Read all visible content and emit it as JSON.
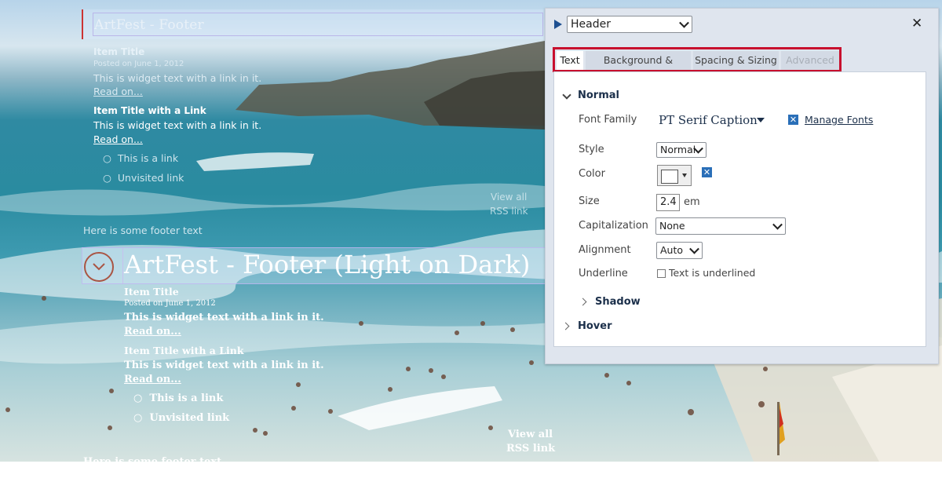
{
  "footer_overlay": {
    "section_title": "ArtFest - Footer",
    "items": [
      {
        "title": "Item Title",
        "date": "Posted on June 1, 2012",
        "text": "This is widget text with a link in it.",
        "read_more": "Read on..."
      },
      {
        "title": "Item Title with a Link",
        "text": "This is widget text with a link in it.",
        "read_more": "Read on..."
      }
    ],
    "links": [
      "This is a link",
      "Unvisited link"
    ],
    "view_all": "View all",
    "rss": "RSS link",
    "footer_text": "Here is some footer text"
  },
  "dark_overlay": {
    "section_title": "ArtFest - Footer (Light on Dark)",
    "items": [
      {
        "title": "Item Title",
        "date": "Posted on June 1, 2012",
        "text": "This is widget text with a link in it.",
        "read_more": "Read on..."
      },
      {
        "title": "Item Title with a Link",
        "text": "This is widget text with a link in it.",
        "read_more": "Read on..."
      }
    ],
    "links": [
      "This is a link",
      "Unvisited link"
    ],
    "view_all": "View all",
    "rss": "RSS link",
    "footer_text": "Here is some footer text"
  },
  "panel": {
    "element_select": "Header",
    "tabs": [
      {
        "label": "Text",
        "state": "active"
      },
      {
        "label": "Background & Border",
        "state": "normal"
      },
      {
        "label": "Spacing & Sizing",
        "state": "normal"
      },
      {
        "label": "Advanced",
        "state": "disabled"
      }
    ],
    "sections": {
      "normal": "Normal",
      "shadow": "Shadow",
      "hover": "Hover"
    },
    "fields": {
      "font_family_label": "Font Family",
      "font_family_value": "PT Serif Caption",
      "manage_fonts": "Manage Fonts",
      "style_label": "Style",
      "style_value": "Normal",
      "color_label": "Color",
      "size_label": "Size",
      "size_value": "2.4",
      "size_unit": "em",
      "capitalization_label": "Capitalization",
      "capitalization_value": "None",
      "alignment_label": "Alignment",
      "alignment_value": "Auto",
      "underline_label": "Underline",
      "underline_checkbox": "Text is underlined"
    },
    "colors": {
      "accent_blue": "#1d4f91",
      "tabs_highlight": "#c8102e",
      "remove_button": "#2a6fb8"
    }
  }
}
